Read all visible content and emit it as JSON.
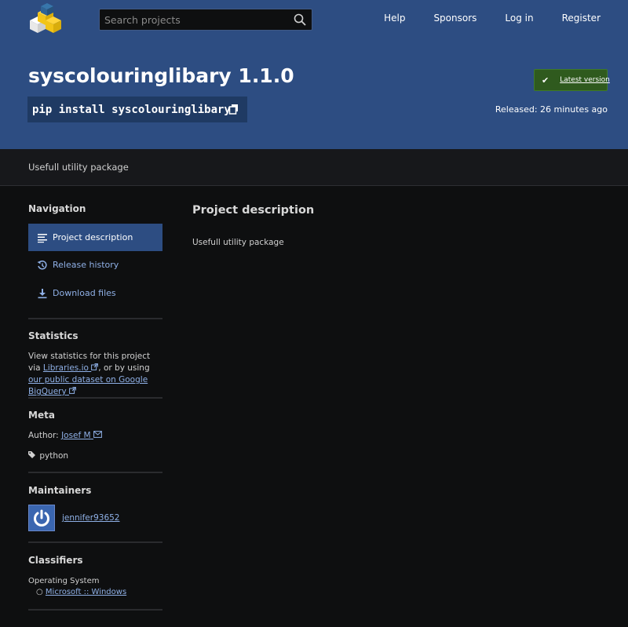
{
  "header": {
    "search_placeholder": "Search projects",
    "nav": [
      "Help",
      "Sponsors",
      "Log in",
      "Register"
    ]
  },
  "package": {
    "title": "syscolouringlibary 1.1.0",
    "pip_command": "pip install syscolouringlibary",
    "latest_label": "Latest version",
    "released": "Released: 26 minutes ago",
    "summary": "Usefull utility package"
  },
  "sidebar": {
    "navigation_heading": "Navigation",
    "nav_items": [
      {
        "label": "Project description",
        "icon": "align-left-icon"
      },
      {
        "label": "Release history",
        "icon": "history-icon"
      },
      {
        "label": "Download files",
        "icon": "download-icon"
      }
    ],
    "statistics_heading": "Statistics",
    "stats_text_1": "View statistics for this project via",
    "stats_link_1": "Libraries.io",
    "stats_text_2": ", or by using",
    "stats_link_2a": "our public",
    "stats_link_2b": "dataset on Google BigQuery",
    "meta_heading": "Meta",
    "author_label": "Author:",
    "author_name": "Josef M",
    "tag": "python",
    "maintainers_heading": "Maintainers",
    "maintainer": "jennifer93652",
    "classifiers_heading": "Classifiers",
    "os_heading": "Operating System",
    "os_item": "Microsoft :: Windows"
  },
  "main": {
    "heading": "Project description",
    "body": "Usefull utility package"
  },
  "colors": {
    "header_bg": "#2d4d82",
    "page_bg": "#0e0f10",
    "link": "#8fb0e6",
    "latest_bg": "#2f5a1e"
  }
}
